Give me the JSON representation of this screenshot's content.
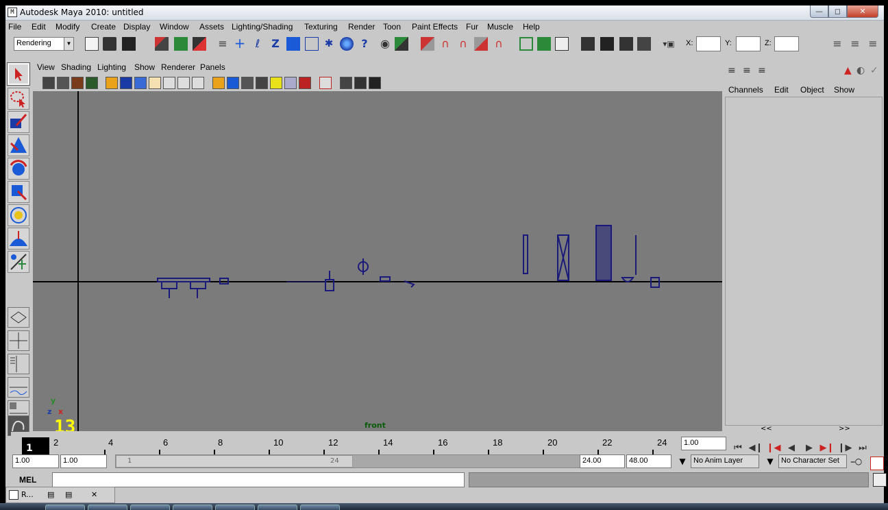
{
  "window": {
    "title": "Autodesk Maya 2010: untitled",
    "app_icon": "maya-app-icon",
    "controls": [
      "minimize",
      "maximize",
      "close"
    ]
  },
  "menubar": {
    "items": [
      "File",
      "Edit",
      "Modify",
      "Create",
      "Display",
      "Window",
      "Assets",
      "Lighting/Shading",
      "Texturing",
      "Render",
      "Toon",
      "Paint Effects",
      "Fur",
      "Muscle",
      "Help"
    ]
  },
  "shelf": {
    "menu_set": "Rendering",
    "x_label": "X:",
    "y_label": "Y:",
    "z_label": "Z:",
    "x_value": "",
    "y_value": "",
    "z_value": ""
  },
  "panel": {
    "menus": [
      "View",
      "Shading",
      "Lighting",
      "Show",
      "Renderer",
      "Panels"
    ],
    "camera_label": "front",
    "axis_x": "x",
    "axis_y": "y",
    "axis_z": "z",
    "frame_number_hud": "13"
  },
  "channel_box": {
    "menus": [
      "Channels",
      "Edit",
      "Object",
      "Show"
    ],
    "scroll_left": "<<",
    "scroll_right": ">>"
  },
  "timeline": {
    "current_frame": "1",
    "tick_labels": [
      "2",
      "4",
      "6",
      "8",
      "10",
      "12",
      "14",
      "16",
      "18",
      "20",
      "22",
      "24"
    ],
    "current_time_field": "1.00"
  },
  "range_slider": {
    "start_time": "1.00",
    "playback_start": "1.00",
    "slider_start": "1",
    "slider_end": "24",
    "playback_end": "24.00",
    "end_time": "48.00",
    "anim_layer": "No Anim Layer",
    "character_set": "No Character Set"
  },
  "command_line": {
    "label": "MEL",
    "value": ""
  },
  "minimized_window": {
    "label": "R..."
  },
  "colors": {
    "ui_gray": "#c8c8c8",
    "viewport_gray": "#7b7b7b",
    "wireframe_blue": "#1a1a7a",
    "hud_yellow": "#ffff00",
    "camera_label_green": "#0a5a0a"
  }
}
